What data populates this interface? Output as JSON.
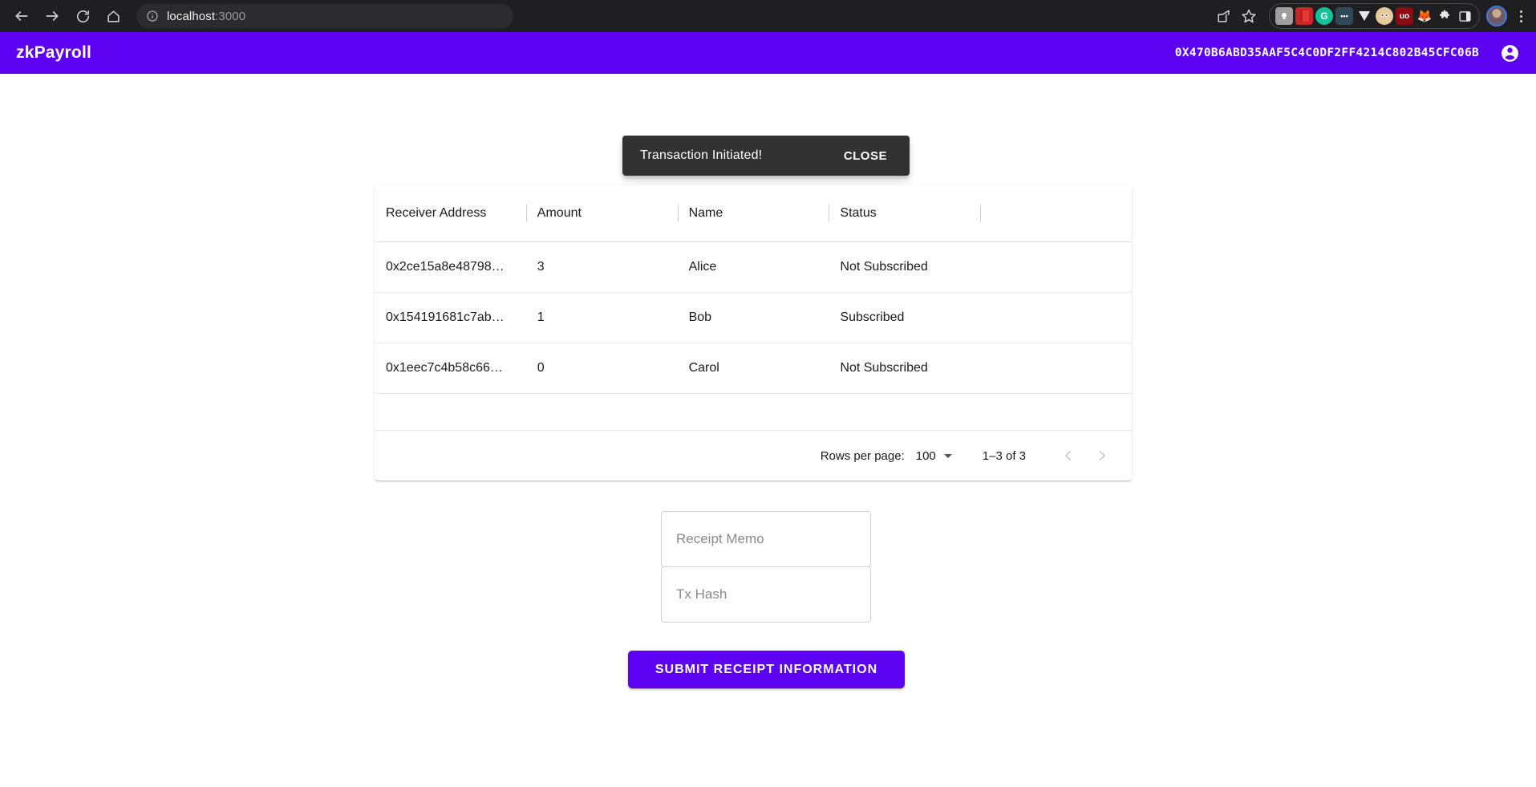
{
  "browser": {
    "back_icon": "arrow-left-icon",
    "forward_icon": "arrow-right-icon",
    "reload_icon": "reload-icon",
    "home_icon": "home-icon",
    "site_info_icon": "info-circle-icon",
    "url_host": "localhost",
    "url_port": ":3000",
    "share_icon": "share-icon",
    "bookmark_icon": "star-icon",
    "extensions": [
      {
        "name": "lightbulb-extension-icon",
        "glyph": "●",
        "bg": "#9e9e9e"
      },
      {
        "name": "book-extension-icon",
        "glyph": "",
        "bg": "#d32f2f"
      },
      {
        "name": "grammarly-extension-icon",
        "glyph": "G",
        "bg": "#15c39a"
      },
      {
        "name": "dots-extension-icon",
        "glyph": "•••",
        "bg": "#2f4858"
      },
      {
        "name": "vercel-extension-icon",
        "glyph": "▼",
        "bg": "#1f1f21"
      },
      {
        "name": "avatar-extension-icon",
        "glyph": "",
        "bg": "#e8c99b"
      },
      {
        "name": "ublock-extension-icon",
        "glyph": "uɔ",
        "bg": "#8b0b14"
      },
      {
        "name": "metamask-extension-icon",
        "glyph": "🦊",
        "bg": "#1f1f21"
      },
      {
        "name": "puzzle-extensions-icon",
        "glyph": "❖",
        "bg": "#1f1f21"
      }
    ],
    "sidepanel_icon": "side-panel-icon",
    "profile_icon": "profile-avatar",
    "menu_icon": "kebab-menu-icon"
  },
  "header": {
    "title": "zkPayroll",
    "wallet_address": "0X470B6ABD35AAF5C4C0DF2FF4214C802B45CFC06B",
    "account_icon": "account-circle-icon",
    "brand_color": "#5c01f2"
  },
  "toast": {
    "message": "Transaction Initiated!",
    "close_label": "CLOSE",
    "bg_color": "#323232"
  },
  "table": {
    "columns": [
      "Receiver Address",
      "Amount",
      "Name",
      "Status",
      ""
    ],
    "rows": [
      {
        "address": "0x2ce15a8e48798…",
        "amount": "3",
        "name": "Alice",
        "status": "Not Subscribed",
        "extra": ""
      },
      {
        "address": "0x154191681c7ab…",
        "amount": "1",
        "name": "Bob",
        "status": "Subscribed",
        "extra": ""
      },
      {
        "address": "0x1eec7c4b58c66…",
        "amount": "0",
        "name": "Carol",
        "status": "Not Subscribed",
        "extra": ""
      }
    ],
    "pagination": {
      "rows_per_page_label": "Rows per page:",
      "rows_per_page_value": "100",
      "range_label": "1–3 of 3",
      "prev_icon": "chevron-left-icon",
      "next_icon": "chevron-right-icon"
    }
  },
  "form": {
    "memo_placeholder": "Receipt Memo",
    "memo_value": "",
    "txhash_placeholder": "Tx Hash",
    "txhash_value": "",
    "submit_label": "SUBMIT RECEIPT INFORMATION"
  }
}
